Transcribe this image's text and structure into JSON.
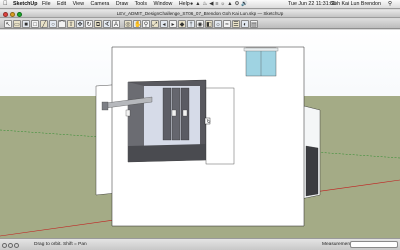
{
  "menubar": {
    "apple_icon": "apple-icon",
    "app_name": "SketchUp",
    "menus": [
      "File",
      "Edit",
      "View",
      "Camera",
      "Draw",
      "Tools",
      "Window",
      "Help"
    ],
    "clock": "Tue Jun 22  11:31:35",
    "user": "Goh Kai Lun Brendon"
  },
  "window": {
    "title": "LEV_ADMIT_DesignChallenge_ST06_07_Brendon Goh Kai Lun.skp — SketchUp",
    "colors": {
      "close": "#e0443e",
      "minimize": "#dea123",
      "zoom": "#1aab29"
    }
  },
  "toolbar": {
    "tools": [
      {
        "name": "select-tool-icon",
        "glyph": "↖"
      },
      {
        "name": "eraser-tool-icon",
        "glyph": "▭"
      },
      {
        "name": "paint-bucket-icon",
        "glyph": "■"
      },
      {
        "name": "rectangle-tool-icon",
        "glyph": "□"
      },
      {
        "name": "line-tool-icon",
        "glyph": "╱"
      },
      {
        "name": "circle-tool-icon",
        "glyph": "○"
      },
      {
        "name": "arc-tool-icon",
        "glyph": "⌒"
      },
      {
        "name": "push-pull-icon",
        "glyph": "⇧"
      },
      {
        "name": "move-tool-icon",
        "glyph": "✥"
      },
      {
        "name": "rotate-tool-icon",
        "glyph": "↻"
      },
      {
        "name": "offset-tool-icon",
        "glyph": "⧉"
      },
      {
        "name": "tape-measure-icon",
        "glyph": "∢"
      },
      {
        "name": "text-tool-icon",
        "glyph": "A"
      },
      {
        "name": "orbit-tool-icon",
        "glyph": "◎"
      },
      {
        "name": "pan-tool-icon",
        "glyph": "✋"
      },
      {
        "name": "zoom-tool-icon",
        "glyph": "⚲"
      },
      {
        "name": "zoom-extents-icon",
        "glyph": "⤢"
      },
      {
        "name": "previous-view-icon",
        "glyph": "◂"
      },
      {
        "name": "next-view-icon",
        "glyph": "▸"
      },
      {
        "name": "components-icon",
        "glyph": "◆"
      },
      {
        "name": "walk-tool-icon",
        "glyph": "†"
      },
      {
        "name": "look-around-icon",
        "glyph": "◉"
      },
      {
        "name": "section-plane-icon",
        "glyph": "◧"
      },
      {
        "name": "shadow-icon",
        "glyph": "☼"
      },
      {
        "name": "fog-icon",
        "glyph": "≈"
      },
      {
        "name": "layers-icon",
        "glyph": "☰"
      },
      {
        "name": "materials-icon",
        "glyph": "◐"
      },
      {
        "name": "styles-icon",
        "glyph": "▤"
      }
    ]
  },
  "colors": {
    "ground": "#a4ab86",
    "sky": "#ffffff",
    "wall": "#ffffff",
    "shadow_face": "#58585e",
    "glass": "#9fd3e2",
    "axis_red": "#c21d1d",
    "axis_green": "#2a8c2a"
  },
  "status": {
    "hint": "Drag to orbit. Shift = Pan",
    "measurements_label": "Measurements",
    "measurements_value": ""
  }
}
